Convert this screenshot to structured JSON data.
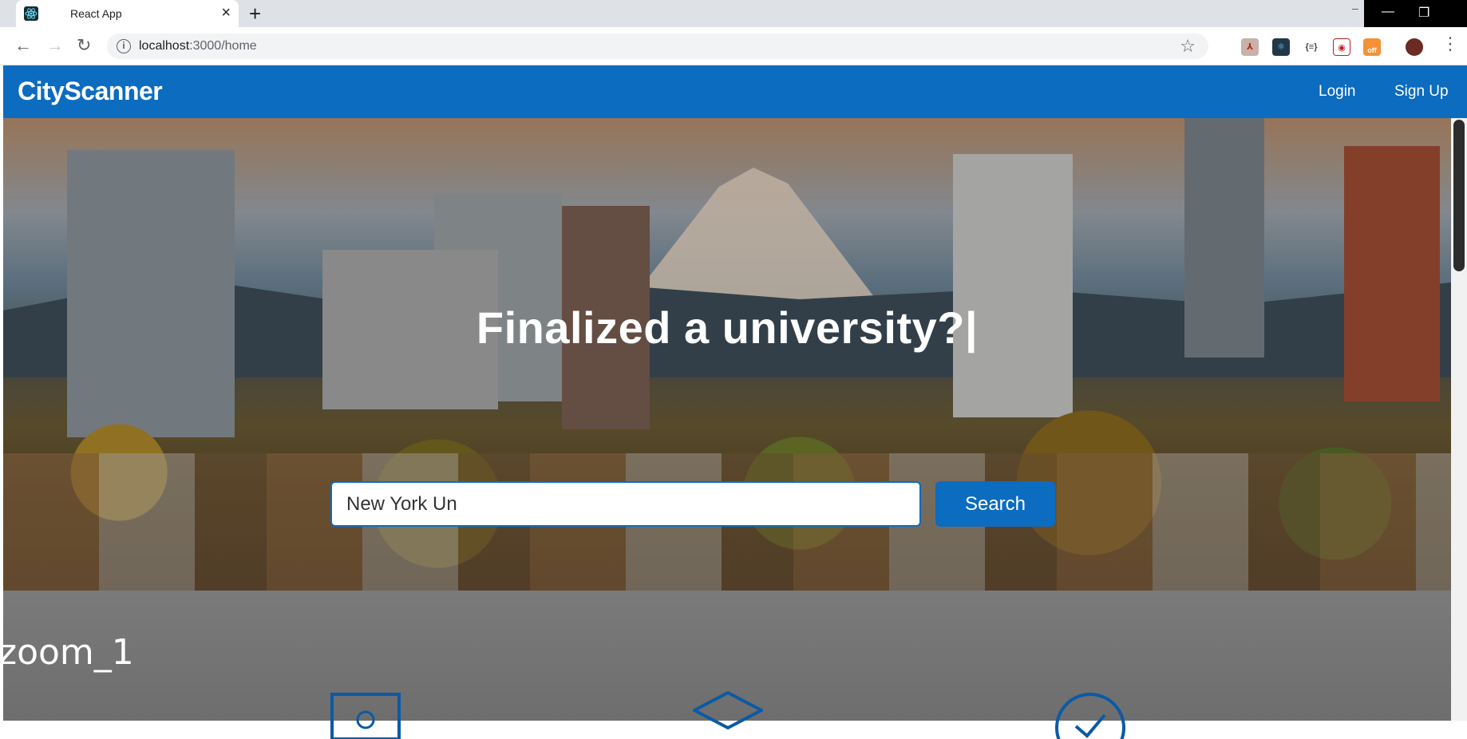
{
  "browser": {
    "tab_title": "React App",
    "url_host": "localhost",
    "url_rest": ":3000/home",
    "extensions": [
      "pdf-icon",
      "react-devtools-icon",
      "json-icon",
      "shield-icon",
      "off-icon",
      "profile-avatar"
    ],
    "off_badge": "off"
  },
  "navbar": {
    "brand": "CityScanner",
    "login": "Login",
    "signup": "Sign Up"
  },
  "hero": {
    "title": "Finalized a university?|",
    "search_value": "New York Un",
    "search_button": "Search"
  },
  "section": {
    "title": "zoom_1"
  },
  "colors": {
    "primary": "#0b6cc0"
  }
}
